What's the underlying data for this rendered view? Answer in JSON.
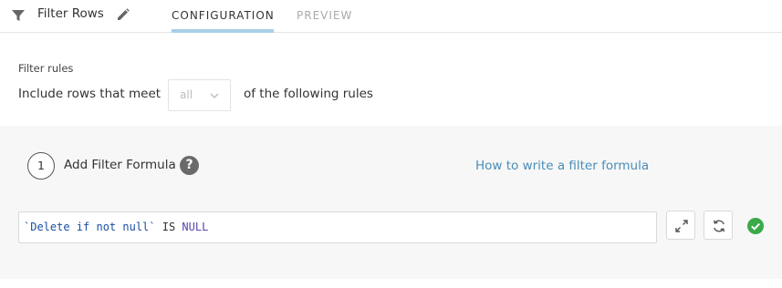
{
  "header": {
    "title": "Filter Rows",
    "tabs": [
      {
        "label": "CONFIGURATION",
        "active": true
      },
      {
        "label": "PREVIEW",
        "active": false
      }
    ]
  },
  "filter_rules": {
    "section_label": "Filter rules",
    "prefix_text": "Include rows that meet",
    "match_select_value": "all",
    "suffix_text": "of the following rules"
  },
  "formula_step": {
    "step_number": "1",
    "label": "Add Filter Formula",
    "help_icon_text": "?",
    "help_link": "How to write a filter formula",
    "formula": {
      "column": "`Delete if not null`",
      "operator": " IS ",
      "value": "NULL"
    }
  },
  "icons": {
    "filter": "filter-icon",
    "edit": "pencil-icon",
    "chevron": "chevron-down-icon",
    "help": "question-circle-icon",
    "expand": "expand-arrows-icon",
    "refresh": "refresh-icon",
    "valid": "check-circle-icon"
  },
  "colors": {
    "tab_underline": "#a8cfe8",
    "link": "#4a8cb8",
    "valid": "#3aaa4a",
    "panel_bg": "#f7f7f7"
  }
}
